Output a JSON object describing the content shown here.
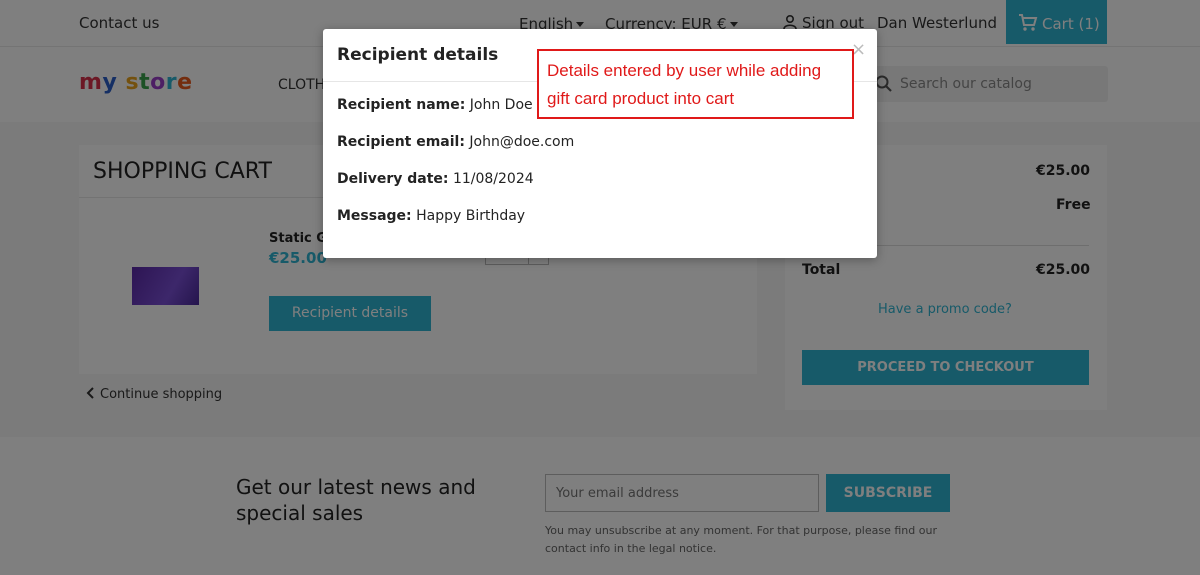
{
  "header": {
    "contact": "Contact us",
    "language": "English",
    "currency": "Currency: EUR €",
    "signout": "Sign out",
    "username": "Dan Westerlund",
    "cart": "Cart (1)"
  },
  "nav": {
    "logo": "my store",
    "menu_clothes": "CLOTH",
    "search_placeholder": "Search our catalog"
  },
  "cart": {
    "title": "SHOPPING CART",
    "product_name": "Static Gi",
    "product_price": "€25.00",
    "recipient_button": "Recipient details",
    "continue": "Continue shopping"
  },
  "summary": {
    "subtotal_value": "€25.00",
    "shipping_value": "Free",
    "total_label": "Total",
    "total_value": "€25.00",
    "promo": "Have a promo code?",
    "checkout": "PROCEED TO CHECKOUT"
  },
  "newsletter": {
    "title": "Get our latest news and special sales",
    "placeholder": "Your email address",
    "subscribe": "SUBSCRIBE",
    "note": "You may unsubscribe at any moment. For that purpose, please find our contact info in the legal notice."
  },
  "modal": {
    "title": "Recipient details",
    "close": "×",
    "name_label": "Recipient name:",
    "name_value": "John Doe",
    "email_label": "Recipient email:",
    "email_value": "John@doe.com",
    "date_label": "Delivery date:",
    "date_value": "11/08/2024",
    "message_label": "Message:",
    "message_value": "Happy Birthday"
  },
  "annotation": {
    "text": "Details entered by user while adding gift card product into cart",
    "color": "#e01919"
  },
  "colors": {
    "accent": "#2fb5d2"
  }
}
